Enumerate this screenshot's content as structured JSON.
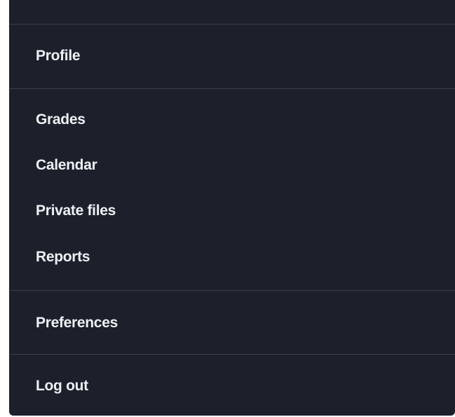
{
  "user_menu": {
    "items": [
      {
        "label": "Profile"
      },
      {
        "label": "Grades"
      },
      {
        "label": "Calendar"
      },
      {
        "label": "Private files"
      },
      {
        "label": "Reports"
      },
      {
        "label": "Preferences"
      },
      {
        "label": "Log out"
      }
    ]
  },
  "colors": {
    "menu_background": "#1d202b",
    "divider": "#3a3e4b",
    "text": "#eef0f4"
  }
}
